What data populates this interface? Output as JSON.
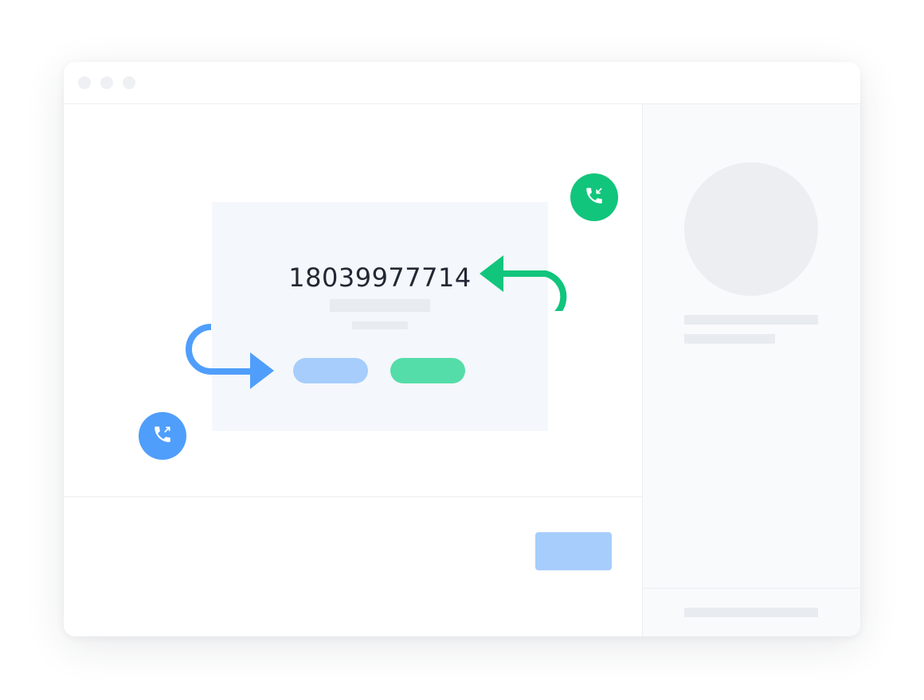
{
  "window": {
    "traffic_lights": [
      "close",
      "minimize",
      "maximize"
    ]
  },
  "call_card": {
    "phone_number": "18039977714"
  },
  "icons": {
    "incoming": "phone-incoming-icon",
    "outgoing": "phone-outgoing-icon"
  },
  "colors": {
    "accent_blue": "#4f9efb",
    "accent_green": "#11c57c",
    "light_blue": "#a7cdfc",
    "light_green": "#54dda8",
    "placeholder_gray": "#e8ebef"
  }
}
